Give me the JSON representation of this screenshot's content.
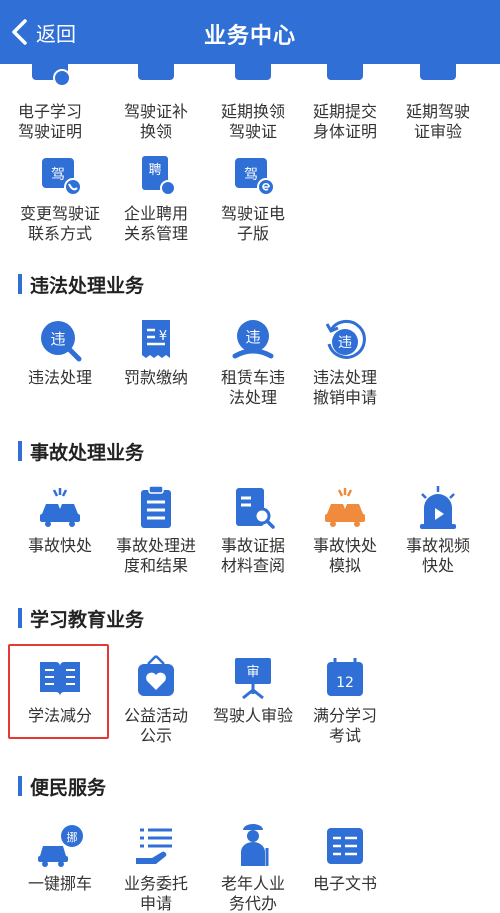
{
  "header": {
    "back_label": "返回",
    "title": "业务中心"
  },
  "colors": {
    "primary": "#2f6fd6",
    "highlight": "#e53935",
    "accent_orange": "#f08a3c"
  },
  "license_items": [
    {
      "line1": "电子学习",
      "line2": "驾驶证明",
      "icon": "license-study-icon"
    },
    {
      "line1": "驾驶证补",
      "line2": "换领",
      "icon": "license-replace-icon"
    },
    {
      "line1": "延期换领",
      "line2": "驾驶证",
      "icon": "license-delay-icon"
    },
    {
      "line1": "延期提交",
      "line2": "身体证明",
      "icon": "health-proof-icon"
    },
    {
      "line1": "延期驾驶",
      "line2": "证审验",
      "icon": "license-review-icon"
    },
    {
      "line1": "变更驾驶证",
      "line2": "联系方式",
      "icon": "contact-change-icon",
      "badge": "驾"
    },
    {
      "line1": "企业聘用",
      "line2": "关系管理",
      "icon": "employment-icon",
      "badge": "聘"
    },
    {
      "line1": "驾驶证电",
      "line2": "子版",
      "icon": "e-license-icon",
      "badge": "驾"
    }
  ],
  "sections": {
    "violation": {
      "title": "违法处理业务",
      "items": [
        {
          "line1": "违法处理",
          "line2": "",
          "badge": "违"
        },
        {
          "line1": "罚款缴纳",
          "line2": "",
          "badge": "¥"
        },
        {
          "line1": "租赁车违",
          "line2": "法处理",
          "badge": "违"
        },
        {
          "line1": "违法处理",
          "line2": "撤销申请",
          "badge": "违"
        }
      ]
    },
    "accident": {
      "title": "事故处理业务",
      "items": [
        {
          "line1": "事故快处",
          "line2": ""
        },
        {
          "line1": "事故处理进",
          "line2": "度和结果"
        },
        {
          "line1": "事故证据",
          "line2": "材料查阅"
        },
        {
          "line1": "事故快处",
          "line2": "模拟"
        },
        {
          "line1": "事故视频",
          "line2": "快处"
        }
      ]
    },
    "education": {
      "title": "学习教育业务",
      "items": [
        {
          "line1": "学法减分",
          "line2": ""
        },
        {
          "line1": "公益活动",
          "line2": "公示"
        },
        {
          "line1": "驾驶人审验",
          "line2": "",
          "badge": "审"
        },
        {
          "line1": "满分学习",
          "line2": "考试",
          "badge": "12"
        }
      ]
    },
    "convenience": {
      "title": "便民服务",
      "items": [
        {
          "line1": "一键挪车",
          "line2": "",
          "badge": "挪"
        },
        {
          "line1": "业务委托",
          "line2": "申请"
        },
        {
          "line1": "老年人业",
          "line2": "务代办"
        },
        {
          "line1": "电子文书",
          "line2": ""
        }
      ]
    }
  }
}
